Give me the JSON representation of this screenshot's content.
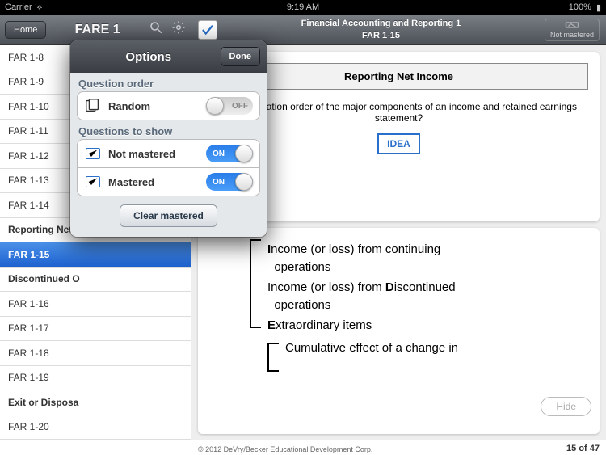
{
  "status": {
    "carrier": "Carrier",
    "time": "9:19 AM",
    "battery": "100%"
  },
  "sidebar": {
    "home": "Home",
    "title": "FARE 1",
    "items": [
      {
        "label": "FAR 1-8"
      },
      {
        "label": "FAR 1-9"
      },
      {
        "label": "FAR 1-10"
      },
      {
        "label": "FAR 1-11"
      },
      {
        "label": "FAR 1-12"
      },
      {
        "label": "FAR 1-13"
      },
      {
        "label": "FAR 1-14"
      },
      {
        "label": "Reporting Net I",
        "section": true
      },
      {
        "label": "FAR 1-15",
        "active": true
      },
      {
        "label": "Discontinued O",
        "section": true
      },
      {
        "label": "FAR 1-16"
      },
      {
        "label": "FAR 1-17"
      },
      {
        "label": "FAR 1-18"
      },
      {
        "label": "FAR 1-19"
      },
      {
        "label": "Exit or Disposa",
        "section": true
      },
      {
        "label": "FAR 1-20"
      }
    ]
  },
  "header": {
    "title": "Financial Accounting and Reporting 1",
    "subtitle": "FAR 1-15",
    "nm": "Not mastered"
  },
  "qcard": {
    "title": "Reporting Net Income",
    "question": "he presentation order of the major components of an income and retained earnings statement?",
    "idea": "IDEA"
  },
  "answer": {
    "l1": "Income (or loss) from continuing operations",
    "l2": "Income (or loss) from Discontinued operations",
    "l3": "Extraordinary items",
    "l4": "Cumulative effect of a change in"
  },
  "footer": {
    "copyright": "© 2012 DeVry/Becker Educational Development Corp.",
    "counter": "15 of 47",
    "hide": "Hide"
  },
  "popover": {
    "title": "Options",
    "done": "Done",
    "s1": "Question order",
    "random": "Random",
    "random_state": "OFF",
    "s2": "Questions to show",
    "nm": "Not mastered",
    "m": "Mastered",
    "on": "ON",
    "clear": "Clear mastered"
  }
}
